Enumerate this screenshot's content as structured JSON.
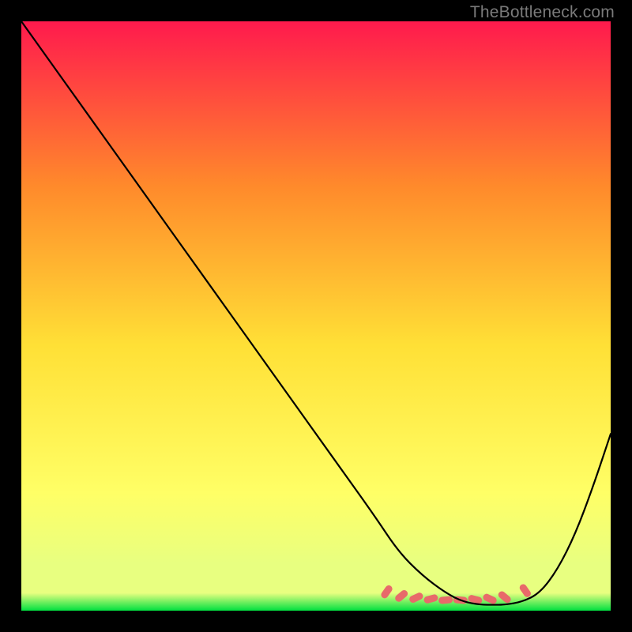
{
  "watermark": "TheBottleneck.com",
  "chart_data": {
    "type": "line",
    "title": "",
    "xlabel": "",
    "ylabel": "",
    "xlim": [
      0,
      100
    ],
    "ylim": [
      0,
      100
    ],
    "background_gradient": {
      "top": "#ff1a4d",
      "mid1": "#ff8a2b",
      "mid2": "#ffe036",
      "mid3": "#ffff66",
      "bottom1": "#e8ff80",
      "bottom2": "#00e040"
    },
    "series": [
      {
        "name": "curve",
        "color": "#000000",
        "x": [
          0,
          5,
          10,
          15,
          20,
          25,
          30,
          35,
          40,
          45,
          50,
          55,
          60,
          64,
          68,
          72,
          75,
          78,
          80,
          82,
          85,
          88,
          91,
          94,
          97,
          100
        ],
        "y": [
          100,
          93,
          86,
          79,
          72,
          65,
          58,
          51,
          44,
          37,
          30,
          23,
          16,
          10,
          6,
          3,
          1.5,
          1,
          1,
          1,
          1.5,
          3,
          7,
          13,
          21,
          30
        ]
      }
    ],
    "markers": {
      "name": "bottom-dots",
      "color": "#e86a6a",
      "shape": "capsule",
      "x": [
        62,
        64.5,
        67,
        69.5,
        72,
        74.5,
        77,
        79.5,
        82,
        85.5
      ],
      "y": [
        3.2,
        2.5,
        2.2,
        2.0,
        1.8,
        1.8,
        1.9,
        2.0,
        2.3,
        3.4
      ],
      "rot": [
        -55,
        -40,
        -25,
        -15,
        -5,
        5,
        15,
        25,
        40,
        55
      ]
    }
  }
}
